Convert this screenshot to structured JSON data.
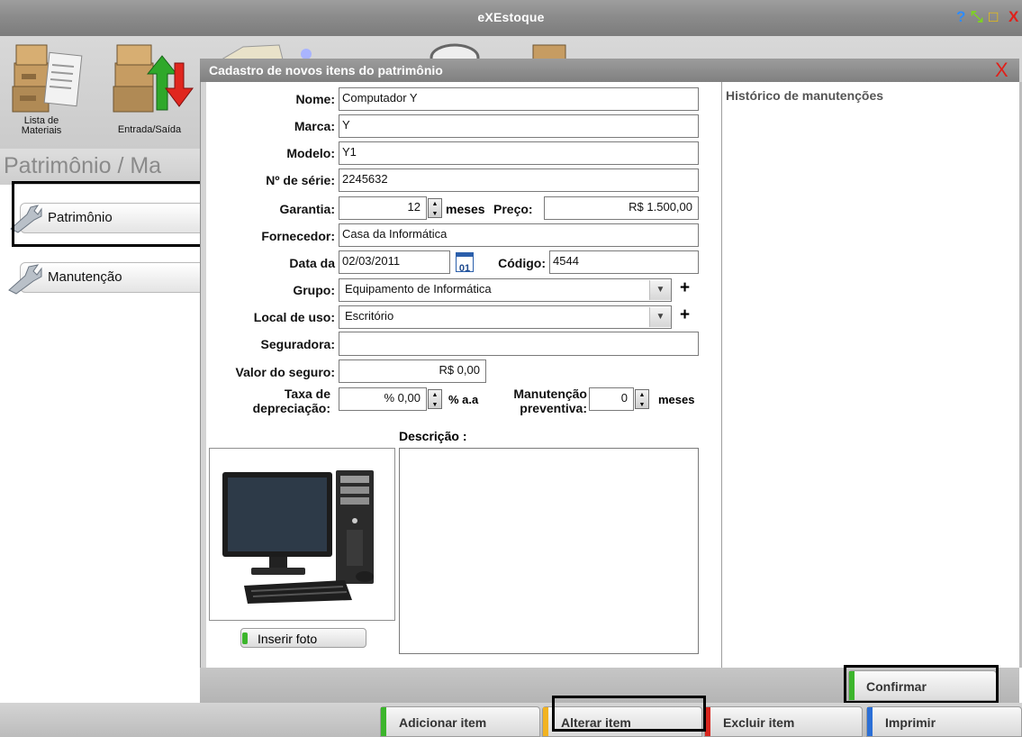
{
  "window": {
    "title": "eXEstoque",
    "help_glyph": "?",
    "minimize_glyph": "⤡",
    "maximize_glyph": "□",
    "close_glyph": "X"
  },
  "toolbar": {
    "items": [
      {
        "label": "Lista de\nMateriais",
        "icon": "boxes-document-icon"
      },
      {
        "label": "Entrada/Saída",
        "icon": "boxes-arrows-icon"
      }
    ]
  },
  "section_title": "Patrimônio / Ma",
  "sidebar": {
    "items": [
      {
        "label": "Patrimônio",
        "icon": "wrench-icon"
      },
      {
        "label": "Manutenção",
        "icon": "wrench-icon"
      }
    ]
  },
  "modal": {
    "title": "Cadastro de novos itens do patrimônio",
    "close_glyph": "X",
    "fields": {
      "nome_label": "Nome:",
      "nome_value": "Computador Y",
      "marca_label": "Marca:",
      "marca_value": "Y",
      "modelo_label": "Modelo:",
      "modelo_value": "Y1",
      "serie_label": "Nº de série:",
      "serie_value": "2245632",
      "garantia_label": "Garantia:",
      "garantia_value": "12",
      "garantia_unit": "meses",
      "preco_label": "Preço:",
      "preco_value": "R$ 1.500,00",
      "fornecedor_label": "Fornecedor:",
      "fornecedor_value": "Casa da Informática",
      "data_label": "Data da",
      "data_value": "02/03/2011",
      "calendar_glyph": "01",
      "codigo_label": "Código:",
      "codigo_value": "4544",
      "grupo_label": "Grupo:",
      "grupo_value": "Equipamento de Informática",
      "local_label": "Local de uso:",
      "local_value": "Escritório",
      "seguradora_label": "Seguradora:",
      "seguradora_value": "",
      "valor_seguro_label": "Valor do seguro:",
      "valor_seguro_value": "R$ 0,00",
      "taxa_label_1": "Taxa de",
      "taxa_label_2": "depreciação:",
      "taxa_value": "% 0,00",
      "taxa_unit": "% a.a",
      "manut_label_1": "Manutenção",
      "manut_label_2": "preventiva:",
      "manut_value": "0",
      "manut_unit": "meses",
      "descricao_label": "Descrição :",
      "plus_glyph": "+"
    },
    "insert_photo_label": "Inserir foto",
    "history_title": "Histórico de manutenções",
    "confirm_label": "Confirmar"
  },
  "bottom_bar": {
    "buttons": [
      {
        "label": "Adicionar item",
        "color": "#3cb52c"
      },
      {
        "label": "Alterar item",
        "color": "#f2b321"
      },
      {
        "label": "Excluir item",
        "color": "#d8261e"
      },
      {
        "label": "Imprimir",
        "color": "#2b6fd6"
      }
    ]
  }
}
